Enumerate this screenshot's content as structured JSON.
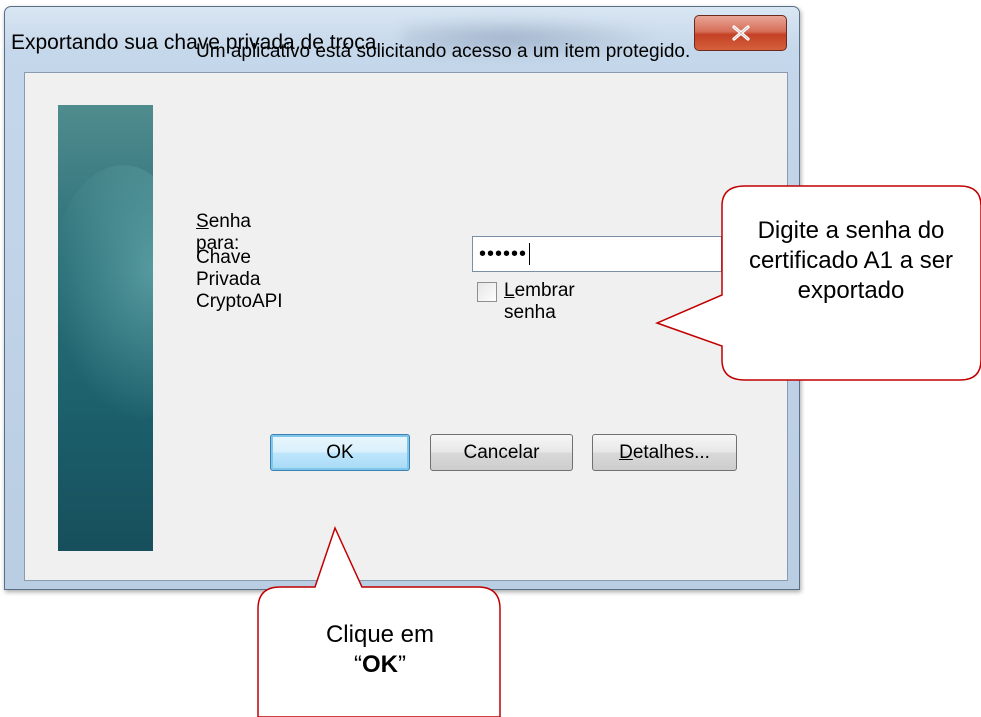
{
  "window": {
    "title": "Exportando sua chave privada de troca",
    "close_icon": "close-icon"
  },
  "dialog": {
    "message": "Um aplicativo está solicitando acesso a um item protegido.",
    "password_label_mnemonic": "S",
    "password_label_rest": "enha para:",
    "key_name": "Chave Privada CryptoAPI",
    "password_value": "••••••",
    "remember": {
      "mnemonic": "L",
      "label_rest": "embrar senha",
      "checked": false
    },
    "buttons": {
      "ok": "OK",
      "cancel": "Cancelar",
      "details_mnemonic": "D",
      "details_rest": "etalhes..."
    }
  },
  "callouts": {
    "password_hint": "Digite a senha do certificado A1 a ser exportado",
    "ok_hint_prefix": "Clique em",
    "ok_hint_open_quote": "“",
    "ok_hint_bold": "OK",
    "ok_hint_close_quote": "”"
  },
  "colors": {
    "callout_border": "#c00000",
    "banner": "#1b5f6b",
    "close_button": "#c44125"
  }
}
